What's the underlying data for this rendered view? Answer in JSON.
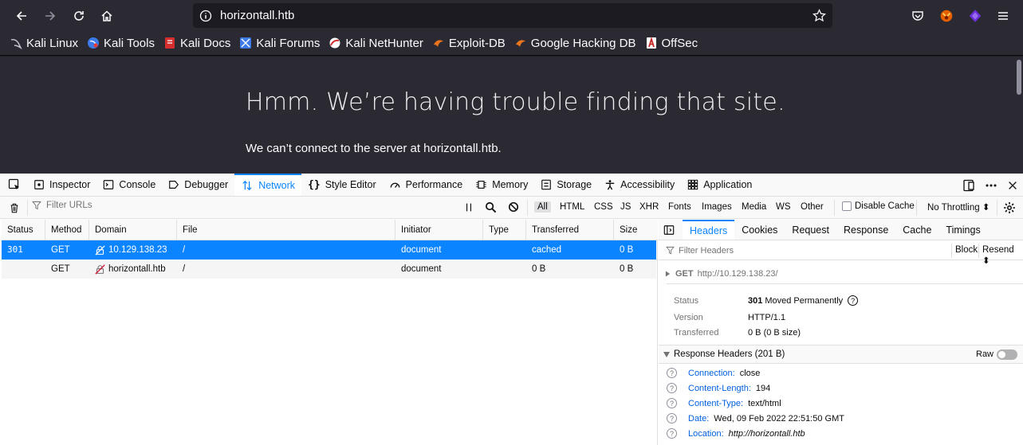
{
  "browser": {
    "url": "horizontall.htb",
    "bookmarks": [
      {
        "label": "Kali Linux",
        "icon": "kali-dragon-icon"
      },
      {
        "label": "Kali Tools",
        "icon": "kali-tools-icon"
      },
      {
        "label": "Kali Docs",
        "icon": "kali-docs-icon"
      },
      {
        "label": "Kali Forums",
        "icon": "kali-forums-icon"
      },
      {
        "label": "Kali NetHunter",
        "icon": "nethunter-icon"
      },
      {
        "label": "Exploit-DB",
        "icon": "exploit-db-icon"
      },
      {
        "label": "Google Hacking DB",
        "icon": "ghdb-icon"
      },
      {
        "label": "OffSec",
        "icon": "offsec-icon"
      }
    ]
  },
  "page": {
    "error_title": "Hmm. We’re having trouble finding that site.",
    "error_text": "We can’t connect to the server at horizontall.htb."
  },
  "devtools": {
    "tabs": [
      "Inspector",
      "Console",
      "Debugger",
      "Network",
      "Style Editor",
      "Performance",
      "Memory",
      "Storage",
      "Accessibility",
      "Application"
    ],
    "active_tab": "Network",
    "toolbar": {
      "filter_placeholder": "Filter URLs",
      "types": [
        "All",
        "HTML",
        "CSS",
        "JS",
        "XHR",
        "Fonts",
        "Images",
        "Media",
        "WS",
        "Other"
      ],
      "disable_cache": "Disable Cache",
      "throttling": "No Throttling ⬍"
    },
    "columns": [
      "Status",
      "Method",
      "Domain",
      "File",
      "Initiator",
      "Type",
      "Transferred",
      "Size"
    ],
    "requests": [
      {
        "status": "301",
        "method": "GET",
        "domain": "10.129.138.23",
        "file": "/",
        "initiator": "document",
        "type": "",
        "transferred": "cached",
        "size": "0 B"
      },
      {
        "status": "",
        "method": "GET",
        "domain": "horizontall.htb",
        "file": "/",
        "initiator": "document",
        "type": "",
        "transferred": "0 B",
        "size": "0 B"
      }
    ],
    "sidebar": {
      "tabs": [
        "Headers",
        "Cookies",
        "Request",
        "Response",
        "Cache",
        "Timings"
      ],
      "active_tab": "Headers",
      "filter_placeholder": "Filter Headers",
      "block_label": "Block",
      "resend_label": "Resend ⬍",
      "request_line": {
        "method": "GET",
        "url": "http://10.129.138.23/"
      },
      "summary": {
        "status_label": "Status",
        "status_code": "301",
        "status_text": "Moved Permanently",
        "version_label": "Version",
        "version": "HTTP/1.1",
        "transferred_label": "Transferred",
        "transferred": "0 B (0 B size)"
      },
      "response_headers_title": "Response Headers (201 B)",
      "raw_label": "Raw",
      "response_headers": [
        {
          "name": "Connection:",
          "value": "close"
        },
        {
          "name": "Content-Length:",
          "value": "194"
        },
        {
          "name": "Content-Type:",
          "value": "text/html"
        },
        {
          "name": "Date:",
          "value": "Wed, 09 Feb 2022 22:51:50 GMT"
        },
        {
          "name": "Location:",
          "value": "http://horizontall.htb"
        }
      ]
    }
  }
}
